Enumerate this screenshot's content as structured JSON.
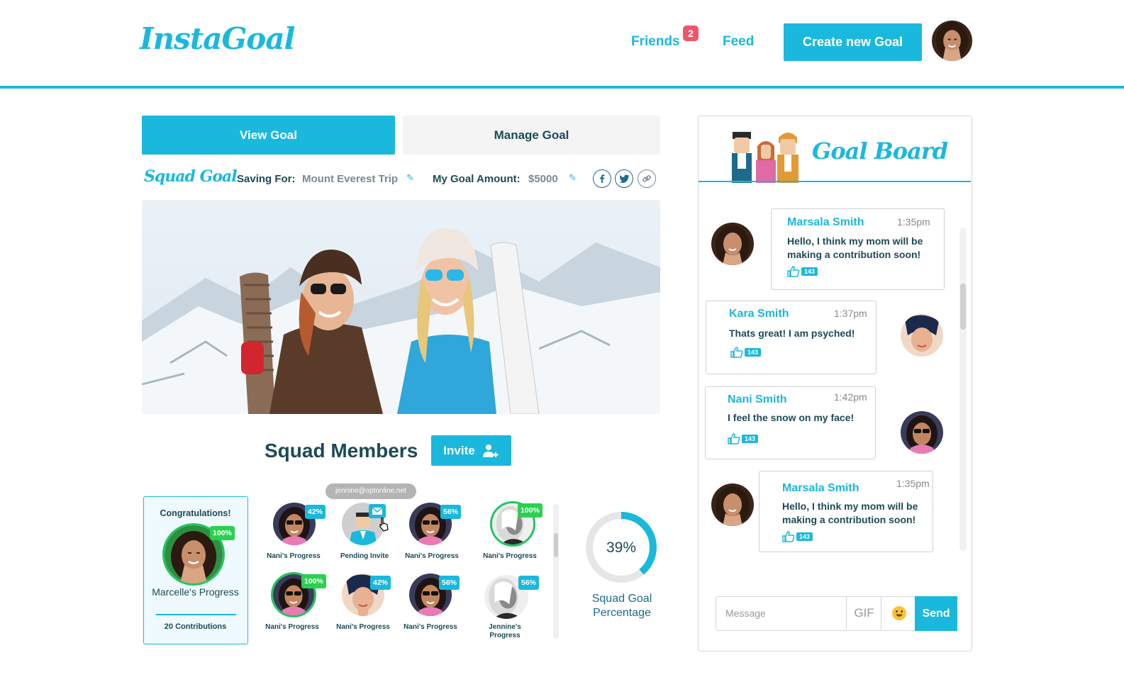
{
  "header": {
    "logo": "InstaGoal",
    "nav": {
      "friends": "Friends",
      "friends_badge": "2",
      "feed": "Feed"
    },
    "create_button": "Create new Goal"
  },
  "tabs": {
    "view": "View Goal",
    "manage": "Manage Goal"
  },
  "goal": {
    "brand": "Squad Goal",
    "saving_for_label": "Saving For:",
    "saving_for_value": "Mount Everest Trip",
    "amount_label": "My Goal Amount:",
    "amount_value": "$5000"
  },
  "squad": {
    "title": "Squad Members",
    "invite_button": "Invite",
    "congrats": {
      "title": "Congratulations!",
      "percent": "100%",
      "name": "Marcelle's Progress",
      "contributions": "20 Contributions"
    },
    "tooltip": "jennine@optonline.net",
    "members": [
      {
        "label": "Nani's Progress",
        "percent": "42%",
        "status": "partial"
      },
      {
        "label": "Pending Invite",
        "percent": "",
        "status": "pending"
      },
      {
        "label": "Nani's Progress",
        "percent": "56%",
        "status": "partial"
      },
      {
        "label": "Nani's Progress",
        "percent": "100%",
        "status": "complete"
      },
      {
        "label": "Nani's Progress",
        "percent": "100%",
        "status": "complete"
      },
      {
        "label": "Nani's Progress",
        "percent": "42%",
        "status": "partial"
      },
      {
        "label": "Nani's Progress",
        "percent": "56%",
        "status": "partial"
      },
      {
        "label": "Jennine's Progress",
        "percent": "56%",
        "status": "partial"
      }
    ],
    "percentage_value": "39%",
    "percentage_fraction": 0.39,
    "percentage_label": "Squad Goal Percentage"
  },
  "board": {
    "title": "Goal Board",
    "messages": [
      {
        "name": "Marsala Smith",
        "time": "1:35pm",
        "text": "Hello, I think my mom will be making a contribution soon!",
        "likes": "143"
      },
      {
        "name": "Kara Smith",
        "time": "1:37pm",
        "text": "Thats great! I am psyched!",
        "likes": "143"
      },
      {
        "name": "Nani Smith",
        "time": "1:42pm",
        "text": "I feel the snow on my face!",
        "likes": "143"
      },
      {
        "name": "Marsala Smith",
        "time": "1:35pm",
        "text": "Hello, I think my mom will be making a contribution soon!",
        "likes": "143"
      }
    ],
    "composer": {
      "placeholder": "Message",
      "gif": "GIF",
      "send": "Send"
    }
  },
  "colors": {
    "accent": "#1ab8dc",
    "success": "#2bd04f",
    "badge": "#f0566b",
    "text": "#1d4a56"
  },
  "icons": [
    "pencil-icon",
    "facebook-icon",
    "twitter-icon",
    "link-icon",
    "add-user-icon",
    "mail-icon",
    "cursor-icon",
    "thumbs-up-icon",
    "emoji-icon"
  ]
}
